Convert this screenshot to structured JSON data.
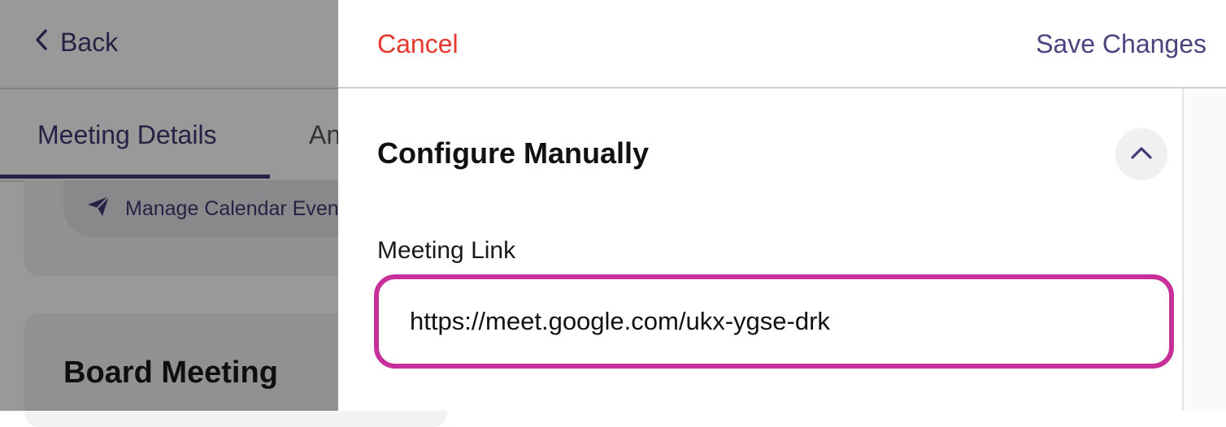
{
  "background": {
    "back_label": "Back",
    "tabs": [
      {
        "label": "Meeting Details",
        "active": true
      },
      {
        "label": "An",
        "active": false
      }
    ],
    "calendar_button_label": "Manage Calendar Event",
    "card_title": "Board Meeting"
  },
  "panel": {
    "cancel_label": "Cancel",
    "save_label": "Save Changes",
    "section_title": "Configure Manually",
    "meeting_link_label": "Meeting Link",
    "meeting_link_value": "https://meet.google.com/ukx-ygse-drk"
  },
  "colors": {
    "accent": "#3f3a73",
    "cancel": "#e8382e",
    "focus_border": "#c7309b"
  },
  "icons": [
    "chevron-left-icon",
    "paper-plane-icon",
    "chevron-up-icon"
  ]
}
